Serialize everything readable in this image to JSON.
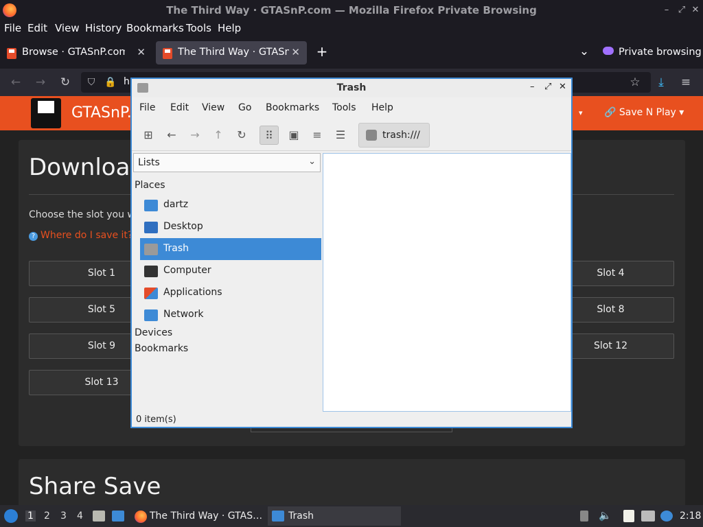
{
  "browser": {
    "window_title": "The Third Way · GTASnP.com — Mozilla Firefox Private Browsing",
    "menu": [
      "File",
      "Edit",
      "View",
      "History",
      "Bookmarks",
      "Tools",
      "Help"
    ],
    "tabs": [
      {
        "label": "Browse · GTASnP.com",
        "active": false
      },
      {
        "label": "The Third Way · GTASnP.c",
        "active": true
      }
    ],
    "private_label": "Private browsing",
    "url_fragment": "h"
  },
  "site": {
    "name": "GTASnP.c",
    "nav_item": "Save N Play",
    "download_heading": "Downloa",
    "choose_text": "Choose the slot you wis",
    "where_link": "Where do I save it?",
    "slots_left": [
      "Slot 1",
      "Slot 5",
      "Slot 9",
      "Slot 13"
    ],
    "slots_right": [
      "Slot 4",
      "Slot 8",
      "Slot 12"
    ],
    "share_heading": "Share Save"
  },
  "file_manager": {
    "title": "Trash",
    "menu": [
      "File",
      "Edit",
      "View",
      "Go",
      "Bookmarks",
      "Tools",
      "Help"
    ],
    "location": "trash:///",
    "side_pane_mode": "Lists",
    "sections": {
      "places": "Places",
      "devices": "Devices",
      "bookmarks": "Bookmarks"
    },
    "places": [
      {
        "label": "dartz",
        "icon": "home-folder-icon",
        "color": "#3d8ad6"
      },
      {
        "label": "Desktop",
        "icon": "desktop-icon",
        "color": "#2f6fc0"
      },
      {
        "label": "Trash",
        "icon": "trash-icon",
        "color": "#9a9a9a",
        "selected": true
      },
      {
        "label": "Computer",
        "icon": "computer-icon",
        "color": "#333333"
      },
      {
        "label": "Applications",
        "icon": "applications-icon",
        "color": "#e44b2a"
      },
      {
        "label": "Network",
        "icon": "network-icon",
        "color": "#3d8ad6"
      }
    ],
    "status": "0 item(s)"
  },
  "taskbar": {
    "workspaces": [
      "1",
      "2",
      "3",
      "4"
    ],
    "tasks": [
      "The Third Way · GTAS…",
      "Trash"
    ],
    "clock": "2:18"
  }
}
